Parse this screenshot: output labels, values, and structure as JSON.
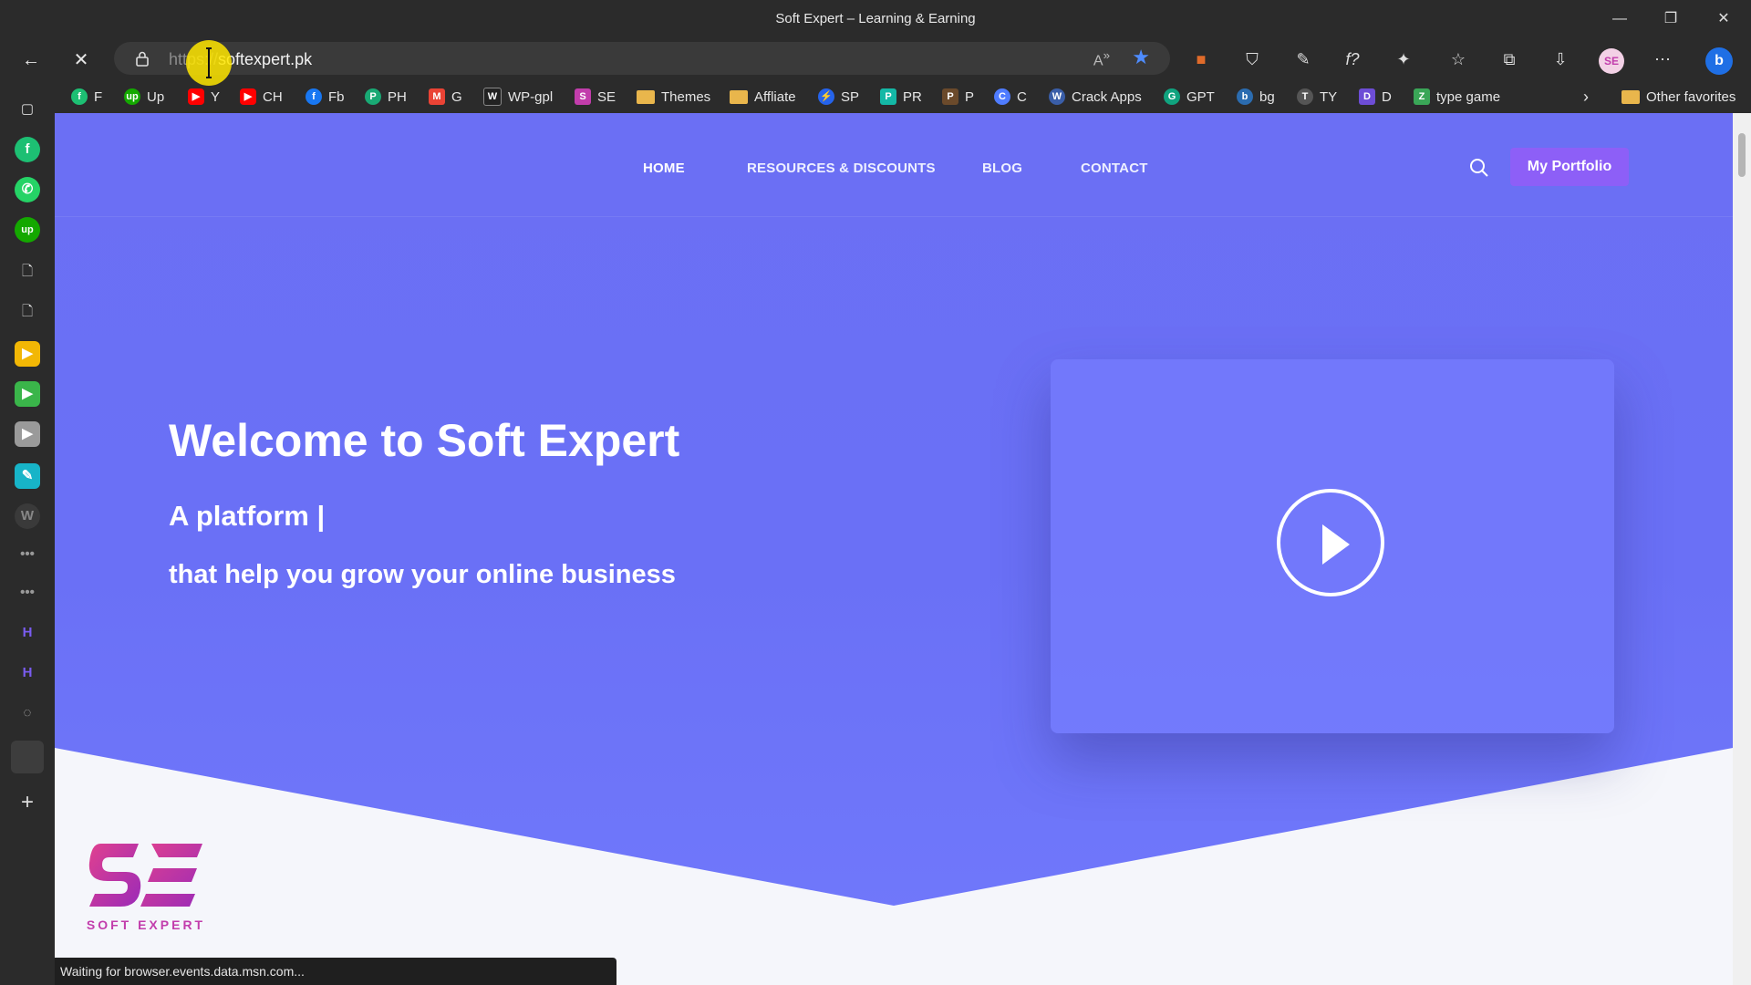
{
  "window": {
    "title": "Soft Expert – Learning & Earning"
  },
  "address": {
    "protocol": "https://",
    "url": "softexpert.pk"
  },
  "bookmarks": [
    {
      "label": "F",
      "color": "#1dbf73",
      "glyph": "f"
    },
    {
      "label": "Up",
      "color": "#14a800",
      "glyph": "up"
    },
    {
      "label": "Y",
      "color": "#ff0000",
      "glyph": "▶"
    },
    {
      "label": "CH",
      "color": "#ff0000",
      "glyph": "▶"
    },
    {
      "label": "Fb",
      "color": "#1877f2",
      "glyph": "f"
    },
    {
      "label": "PH",
      "color": "#19a974",
      "glyph": "P"
    },
    {
      "label": "G",
      "color": "#ea4335",
      "glyph": "M"
    },
    {
      "label": "WP-gpl",
      "color": "#222222",
      "glyph": "W"
    },
    {
      "label": "SE",
      "color": "#c23dac",
      "glyph": "S"
    },
    {
      "label": "Themes",
      "folder": true
    },
    {
      "label": "Affliate",
      "folder": true
    },
    {
      "label": "SP",
      "color": "#2563eb",
      "glyph": "⚡"
    },
    {
      "label": "PR",
      "color": "#14b8a6",
      "glyph": "P"
    },
    {
      "label": "P",
      "color": "#6b4a2b",
      "glyph": "P"
    },
    {
      "label": "C",
      "color": "#4f7cff",
      "glyph": "C"
    },
    {
      "label": "Crack Apps",
      "color": "#3a5ea8",
      "glyph": "W"
    },
    {
      "label": "GPT",
      "color": "#10a37f",
      "glyph": "G"
    },
    {
      "label": "bg",
      "color": "#2b6cb0",
      "glyph": "b"
    },
    {
      "label": "TY",
      "color": "#555555",
      "glyph": "T"
    },
    {
      "label": "D",
      "color": "#6d4dd6",
      "glyph": "D"
    },
    {
      "label": "type game",
      "color": "#3aa657",
      "glyph": "Z"
    }
  ],
  "other_favorites": "Other favorites",
  "site": {
    "menu": [
      "HOME",
      "RESOURCES & DISCOUNTS",
      "BLOG",
      "CONTACT"
    ],
    "portfolio_button": "My Portfolio",
    "hero_title": "Welcome to Soft Expert",
    "hero_subtitle": "A platform |",
    "hero_tagline": "that help you grow your online business",
    "logo_text": "SOFT EXPERT"
  },
  "status_text": "Waiting for browser.events.data.msn.com...",
  "colors": {
    "hero": "#6b6ff4",
    "button": "#8d5ff7",
    "brand": "#c23dac"
  }
}
